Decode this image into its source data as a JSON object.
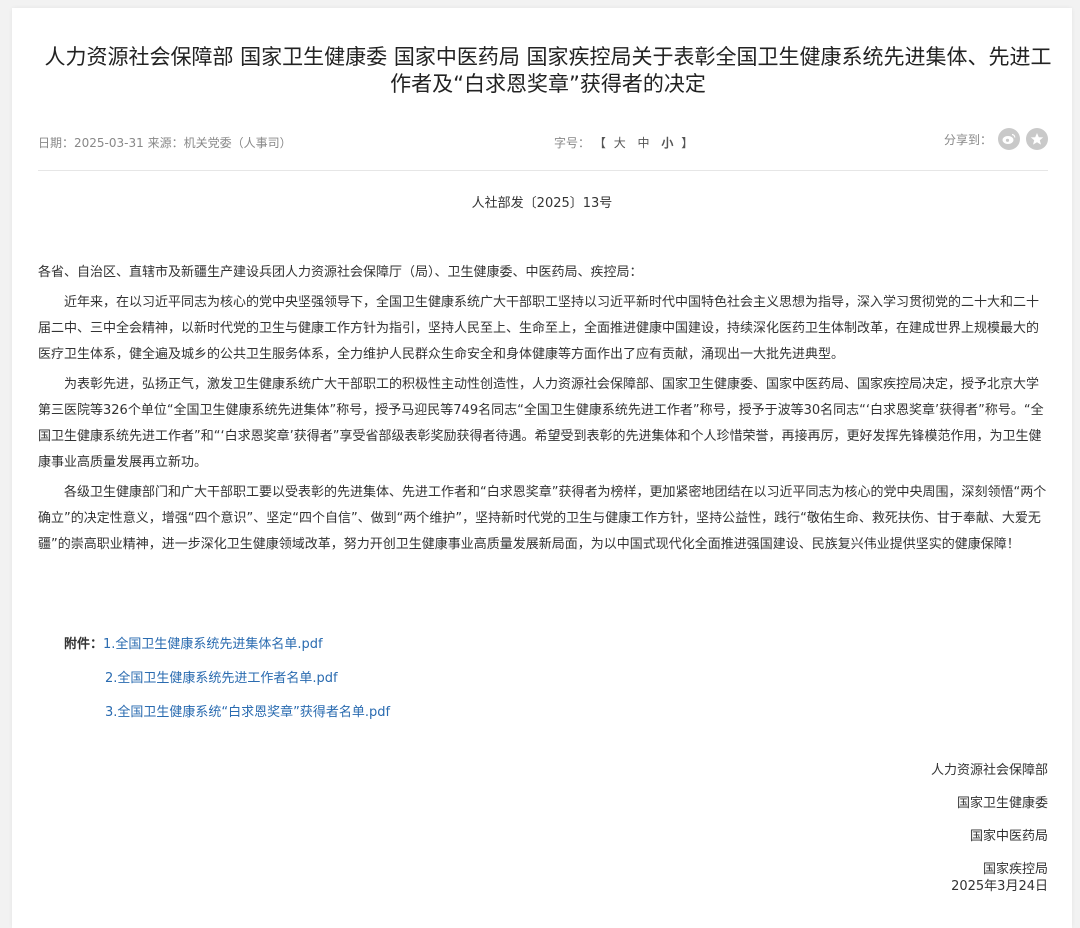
{
  "title": "人力资源社会保障部 国家卫生健康委 国家中医药局 国家疾控局关于表彰全国卫生健康系统先进集体、先进工作者及“白求恩奖章”获得者的决定",
  "meta": {
    "date_label": "日期：",
    "date": "2025-03-31",
    "source_label": "来源：",
    "source": "机关党委（人事司）",
    "font_label": "字号：",
    "bracket_open": "【",
    "size_large": "大",
    "size_medium": "中",
    "size_small": "小",
    "bracket_close": "】",
    "share_label": "分享到：",
    "share_icons": [
      "weibo-icon",
      "favorite-icon"
    ]
  },
  "doc_number": "人社部发〔2025〕13号",
  "salutation": "各省、自治区、直辖市及新疆生产建设兵团人力资源社会保障厅（局）、卫生健康委、中医药局、疾控局：",
  "paragraphs": [
    "近年来，在以习近平同志为核心的党中央坚强领导下，全国卫生健康系统广大干部职工坚持以习近平新时代中国特色社会主义思想为指导，深入学习贯彻党的二十大和二十届二中、三中全会精神，以新时代党的卫生与健康工作方针为指引，坚持人民至上、生命至上，全面推进健康中国建设，持续深化医药卫生体制改革，在建成世界上规模最大的医疗卫生体系，健全遍及城乡的公共卫生服务体系，全力维护人民群众生命安全和身体健康等方面作出了应有贡献，涌现出一大批先进典型。",
    "为表彰先进，弘扬正气，激发卫生健康系统广大干部职工的积极性主动性创造性，人力资源社会保障部、国家卫生健康委、国家中医药局、国家疾控局决定，授予北京大学第三医院等326个单位“全国卫生健康系统先进集体”称号，授予马迎民等749名同志“全国卫生健康系统先进工作者”称号，授予于波等30名同志“‘白求恩奖章’获得者”称号。“全国卫生健康系统先进工作者”和“‘白求恩奖章’获得者”享受省部级表彰奖励获得者待遇。希望受到表彰的先进集体和个人珍惜荣誉，再接再厉，更好发挥先锋模范作用，为卫生健康事业高质量发展再立新功。",
    "各级卫生健康部门和广大干部职工要以受表彰的先进集体、先进工作者和“白求恩奖章”获得者为榜样，更加紧密地团结在以习近平同志为核心的党中央周围，深刻领悟“两个确立”的决定性意义，增强“四个意识”、坚定“四个自信”、做到“两个维护”，坚持新时代党的卫生与健康工作方针，坚持公益性，践行“敬佑生命、救死扶伤、甘于奉献、大爱无疆”的崇高职业精神，进一步深化卫生健康领域改革，努力开创卫生健康事业高质量发展新局面，为以中国式现代化全面推进强国建设、民族复兴伟业提供坚实的健康保障！"
  ],
  "attachments": {
    "label": "附件：",
    "items": [
      "1.全国卫生健康系统先进集体名单.pdf",
      "2.全国卫生健康系统先进工作者名单.pdf",
      "3.全国卫生健康系统“白求恩奖章”获得者名单.pdf"
    ]
  },
  "signatures": [
    "人力资源社会保障部",
    "国家卫生健康委",
    "国家中医药局",
    "国家疾控局"
  ],
  "sign_date": "2025年3月24日"
}
